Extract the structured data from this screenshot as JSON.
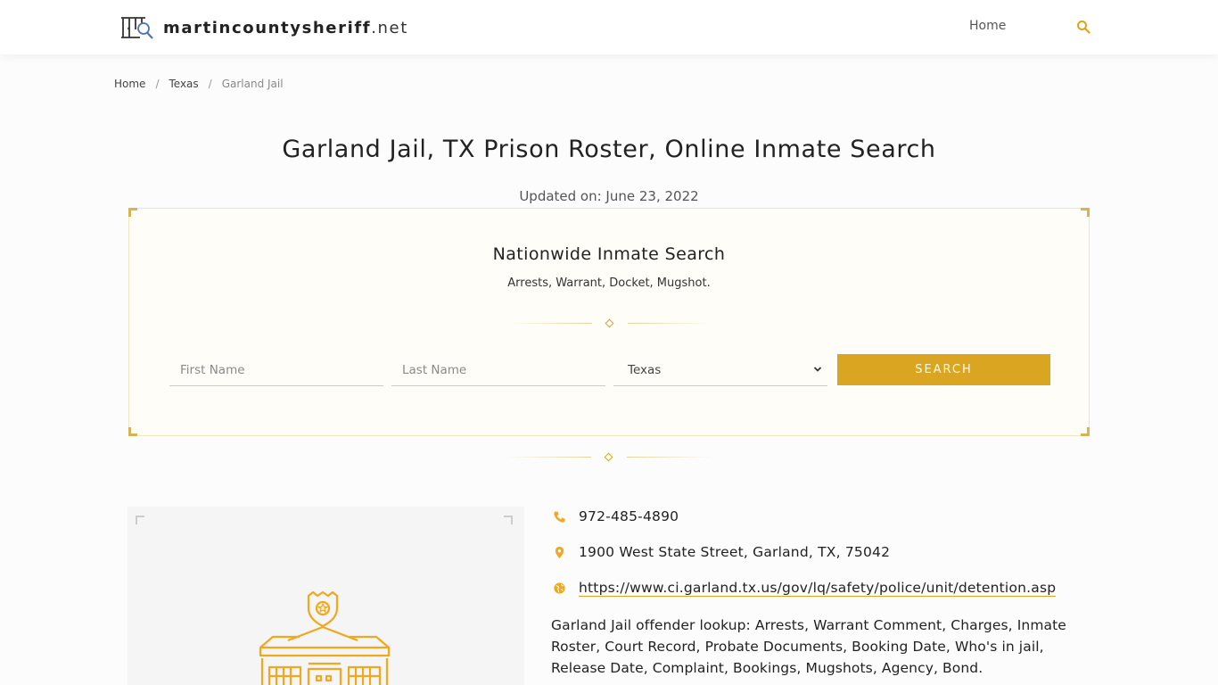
{
  "header": {
    "logo_name": "martincountysheriff",
    "logo_tld": ".net",
    "nav_home": "Home",
    "search_icon": "search-icon"
  },
  "breadcrumb": {
    "items": [
      "Home",
      "Texas"
    ],
    "separator": "/",
    "current": "Garland Jail"
  },
  "page": {
    "title": "Garland Jail, TX Prison Roster, Online Inmate Search",
    "updated": "Updated on: June 23, 2022"
  },
  "search_box": {
    "title": "Nationwide Inmate Search",
    "subtitle": "Arrests, Warrant, Docket, Mugshot.",
    "first_name_placeholder": "First Name",
    "last_name_placeholder": "Last Name",
    "state_selected": "Texas",
    "search_label": "SEARCH"
  },
  "info": {
    "phone": "972-485-4890",
    "address": "1900 West State Street, Garland, TX, 75042",
    "website": "https://www.ci.garland.tx.us/gov/lq/safety/police/unit/detention.asp",
    "description": "Garland Jail offender lookup: Arrests, Warrant Comment, Charges, Inmate Roster, Court Record, Probate Documents, Booking Date, Who's in jail, Release Date, Complaint, Bookings, Mugshots, Agency, Bond."
  },
  "colors": {
    "accent": "#daa520",
    "box_bg": "#fffdf7",
    "text": "#222222"
  }
}
